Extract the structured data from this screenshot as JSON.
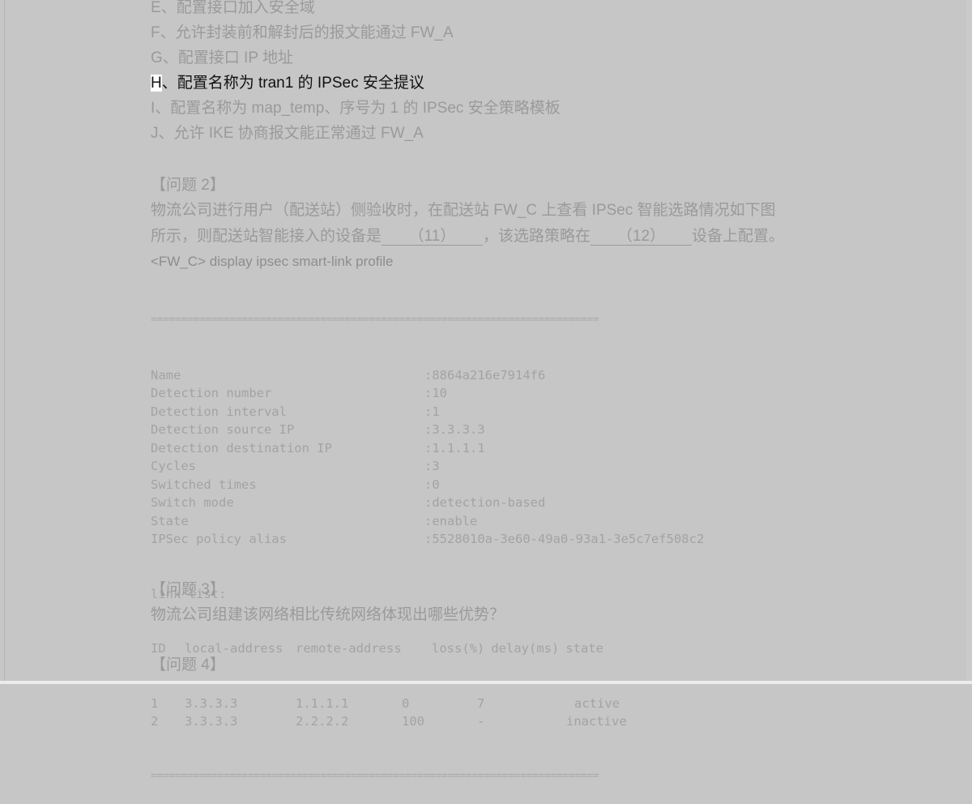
{
  "options": [
    {
      "letter": "E",
      "text": "、配置接口加入安全域"
    },
    {
      "letter": "F",
      "text": "、允许封装前和解封后的报文能通过 FW_A"
    },
    {
      "letter": "G",
      "text": "、配置接口 IP 地址"
    },
    {
      "letter": "H",
      "text": "、配置名称为 tran1 的 IPSec 安全提议"
    },
    {
      "letter": "I",
      "text": "、配置名称为 map_temp、序号为 1 的 IPSec 安全策略模板"
    },
    {
      "letter": "J",
      "text": "、允许 IKE 协商报文能正常通过 FW_A"
    }
  ],
  "question2": {
    "heading": "【问题 2】",
    "line1": "物流公司进行用户（配送站）侧验收时，在配送站 FW_C 上查看 IPSec 智能选路情况如下图",
    "line2_a": "所示，则配送站智能接入的设备是",
    "blank11": "（11）",
    "line2_b": "，该选路策略在",
    "blank12": "（12）",
    "line2_c": "设备上配置。",
    "command": "<FW_C> display ipsec smart-link profile"
  },
  "cli": {
    "separator": "==========================================================================",
    "fields": [
      {
        "key": "Name",
        "value": ":8864a216e7914f6"
      },
      {
        "key": "Detection number",
        "value": ":10"
      },
      {
        "key": "Detection interval",
        "value": ":1"
      },
      {
        "key": "Detection source IP",
        "value": ":3.3.3.3"
      },
      {
        "key": "Detection destination IP",
        "value": ":1.1.1.1"
      },
      {
        "key": "Cycles",
        "value": ":3"
      },
      {
        "key": "Switched times",
        "value": ":0"
      },
      {
        "key": "Switch mode",
        "value": ":detection-based"
      },
      {
        "key": "State",
        "value": ":enable"
      },
      {
        "key": "IPSec policy alias",
        "value": ":5528010a-3e60-49a0-93a1-3e5c7ef508c2"
      }
    ],
    "link_list_label": "link list:",
    "table_header": [
      "ID",
      "local-address",
      "remote-address",
      "loss(%)",
      "delay(ms)",
      "state"
    ],
    "rows": [
      [
        "1",
        "3.3.3.3",
        "1.1.1.1",
        "0",
        "7",
        "active"
      ],
      [
        "2",
        "3.3.3.3",
        "2.2.2.2",
        "100",
        "-",
        "inactive"
      ]
    ]
  },
  "question3": {
    "heading": "【问题 3】",
    "text": "物流公司组建该网络相比传统网络体现出哪些优势？"
  },
  "question4": {
    "heading": "【问题 4】"
  }
}
